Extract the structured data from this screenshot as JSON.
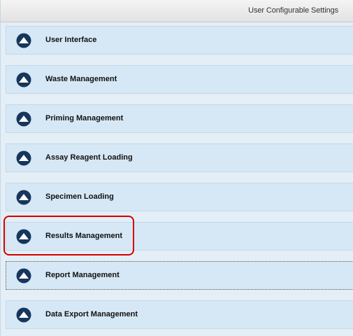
{
  "header": {
    "title": "User Configurable Settings"
  },
  "sections": [
    {
      "label": "User Interface",
      "icon": "chevron-up-icon",
      "expanded": false
    },
    {
      "label": "Waste Management",
      "icon": "chevron-up-icon",
      "expanded": false
    },
    {
      "label": "Priming Management",
      "icon": "chevron-up-icon",
      "expanded": false
    },
    {
      "label": "Assay Reagent Loading",
      "icon": "chevron-up-icon",
      "expanded": false
    },
    {
      "label": "Specimen Loading",
      "icon": "chevron-up-icon",
      "expanded": false
    },
    {
      "label": "Results Management",
      "icon": "chevron-up-icon",
      "expanded": false,
      "highlighted": true
    },
    {
      "label": "Report Management",
      "icon": "chevron-up-icon",
      "expanded": false,
      "focused": true
    },
    {
      "label": "Data Export Management",
      "icon": "chevron-up-icon",
      "expanded": false
    }
  ],
  "colors": {
    "panel_background": "#e4eef6",
    "section_background": "#d6e8f5",
    "icon_fill": "#17365d",
    "highlight_border": "#d40000"
  }
}
